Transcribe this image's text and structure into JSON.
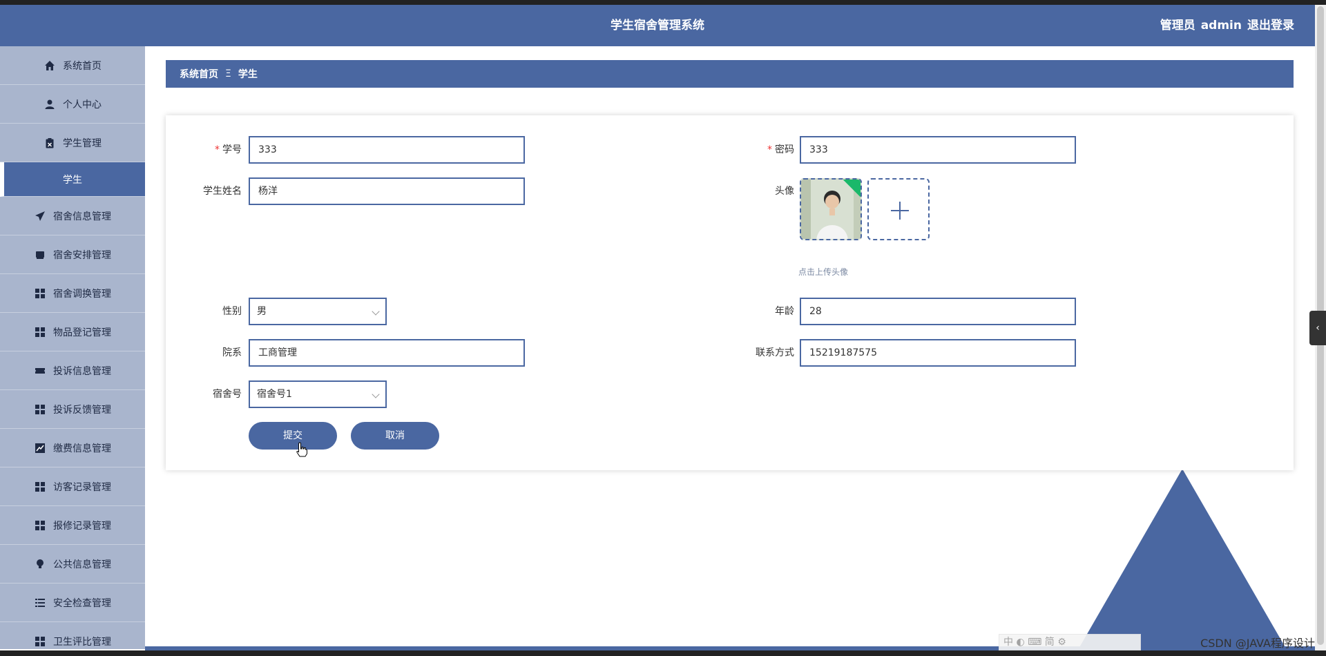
{
  "header": {
    "title": "学生宿舍管理系统",
    "role": "管理员",
    "username": "admin",
    "logout": "退出登录"
  },
  "sidebar": {
    "items": [
      {
        "label": "系统首页",
        "icon": "home-icon"
      },
      {
        "label": "个人中心",
        "icon": "user-icon"
      },
      {
        "label": "学生管理",
        "icon": "clipboard-icon"
      },
      {
        "label": "学生",
        "sub": true
      },
      {
        "label": "宿舍信息管理",
        "icon": "send-icon"
      },
      {
        "label": "宿舍安排管理",
        "icon": "inbox-icon"
      },
      {
        "label": "宿舍调换管理",
        "icon": "grid-icon"
      },
      {
        "label": "物品登记管理",
        "icon": "grid-icon"
      },
      {
        "label": "投诉信息管理",
        "icon": "ticket-icon"
      },
      {
        "label": "投诉反馈管理",
        "icon": "grid-icon"
      },
      {
        "label": "缴费信息管理",
        "icon": "chart-icon"
      },
      {
        "label": "访客记录管理",
        "icon": "grid-icon"
      },
      {
        "label": "报修记录管理",
        "icon": "grid-icon"
      },
      {
        "label": "公共信息管理",
        "icon": "bulb-icon"
      },
      {
        "label": "安全检查管理",
        "icon": "list-icon"
      },
      {
        "label": "卫生评比管理",
        "icon": "grid-icon"
      }
    ]
  },
  "breadcrumb": {
    "home": "系统首页",
    "separator": "Ξ",
    "current": "学生"
  },
  "form": {
    "student_id": {
      "label": "学号",
      "value": "333",
      "required": "*"
    },
    "password": {
      "label": "密码",
      "value": "333",
      "required": "*"
    },
    "name": {
      "label": "学生姓名",
      "value": "杨洋"
    },
    "avatar": {
      "label": "头像",
      "hint": "点击上传头像"
    },
    "gender": {
      "label": "性别",
      "value": "男"
    },
    "age": {
      "label": "年龄",
      "value": "28"
    },
    "department": {
      "label": "院系",
      "value": "工商管理"
    },
    "contact": {
      "label": "联系方式",
      "value": "15219187575"
    },
    "dorm": {
      "label": "宿舍号",
      "value": "宿舍号1"
    },
    "submit": "提交",
    "cancel": "取消"
  },
  "side_tab": "‹",
  "watermark": "CSDN @JAVA程序设计",
  "ime_toolbar": "中 ◐ ⌨ 简 ⚙",
  "colors": {
    "primary": "#4a67a1",
    "sidebar_bg": "#a9b5cd",
    "required": "#ee3333"
  }
}
